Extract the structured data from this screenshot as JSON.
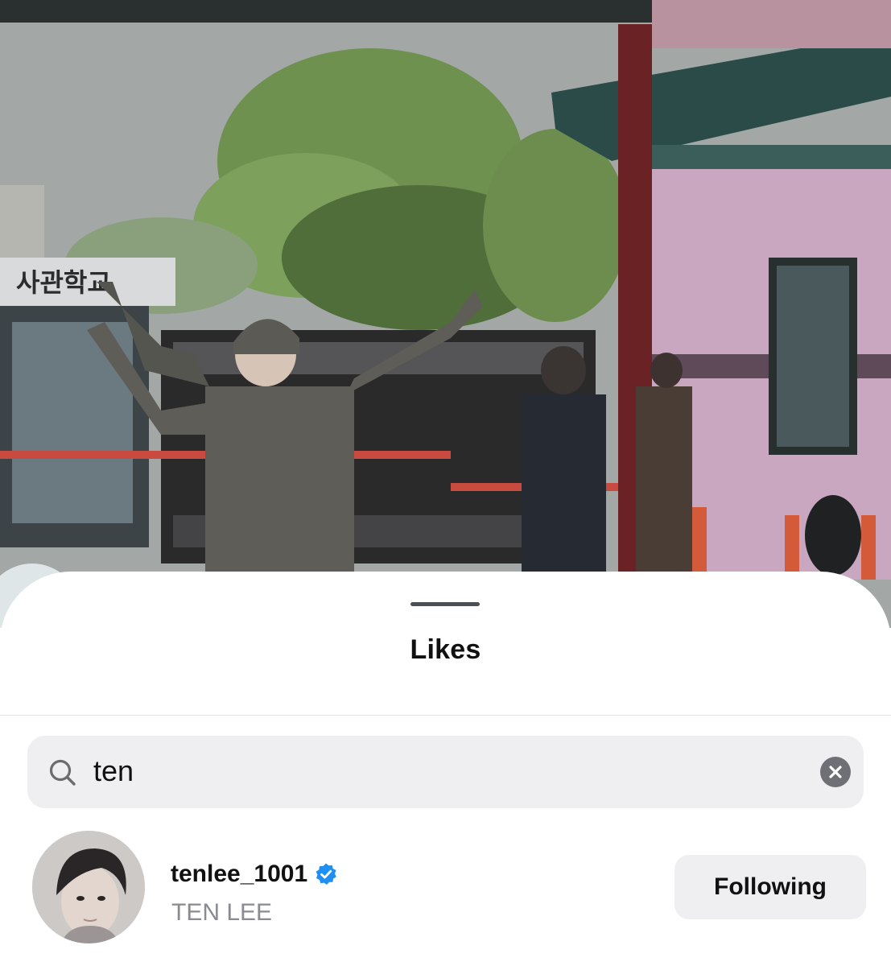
{
  "background": {
    "sign_text": "사관학교"
  },
  "sheet": {
    "title": "Likes"
  },
  "search": {
    "value": "ten",
    "icon": "search-icon",
    "clear_icon": "clear-icon"
  },
  "results": [
    {
      "username": "tenlee_1001",
      "full_name": "TEN LEE",
      "verified": true,
      "button_label": "Following"
    }
  ],
  "colors": {
    "verified_blue": "#1e8ff5",
    "button_bg": "#efeff2",
    "secondary_text": "#8a8b90"
  }
}
